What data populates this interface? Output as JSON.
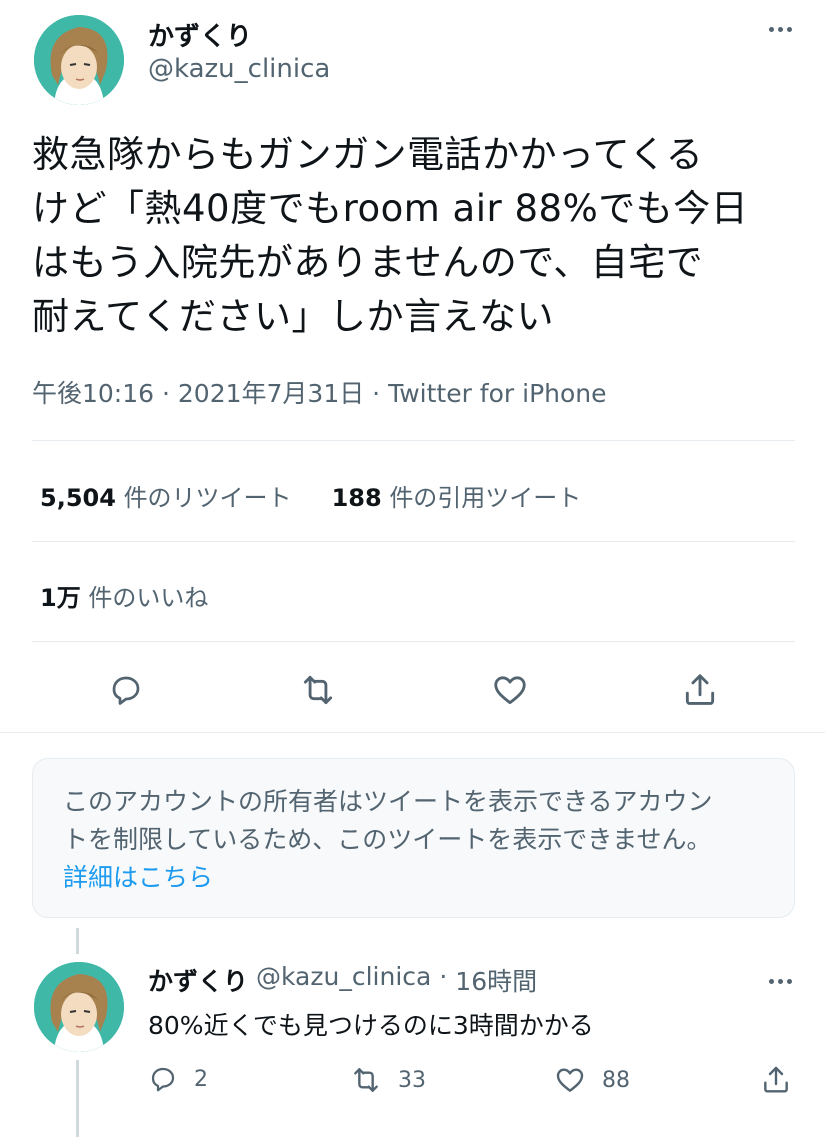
{
  "tweet": {
    "author_name": "かずくり",
    "author_handle": "@kazu_clinica",
    "text_lines": [
      "救急隊からもガンガン電話かかってくる",
      "けど「熱40度でもroom air 88%でも今日",
      "はもう入院先がありませんので、自宅で",
      "耐えてください」しか言えない"
    ],
    "meta": "午後10:16 · 2021年7月31日 · Twitter for iPhone",
    "stats": {
      "retweets_count": "5,504",
      "retweets_label": "件のリツイート",
      "quotes_count": "188",
      "quotes_label": "件の引用ツイート",
      "likes_count": "1万",
      "likes_label": "件のいいね"
    }
  },
  "notice": {
    "line1": "このアカウントの所有者はツイートを表示できるアカウン",
    "line2": "トを制限しているため、このツイートを表示できません。",
    "link": "詳細はこちら"
  },
  "reply": {
    "author_name": "かずくり",
    "author_handle": "@kazu_clinica",
    "separator": "·",
    "time": "16時間",
    "text": "80%近くでも見つけるのに3時間かかる",
    "reply_count": "2",
    "retweet_count": "33",
    "like_count": "88"
  },
  "icons": {
    "reply": "reply-icon",
    "retweet": "retweet-icon",
    "like": "heart-icon",
    "share": "share-icon",
    "more": "more-icon"
  },
  "colors": {
    "accent": "#1d9bf0",
    "secondary_text": "#536471",
    "avatar_bg": "#3fb8a8"
  }
}
